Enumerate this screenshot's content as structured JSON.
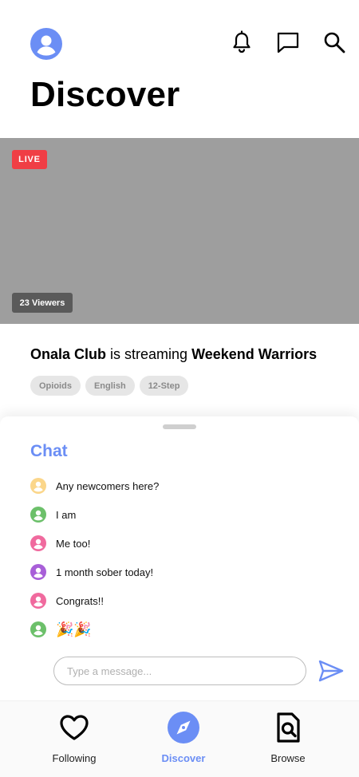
{
  "header": {
    "title": "Discover",
    "icons": [
      "profile-icon",
      "bell-icon",
      "chat-bubble-icon",
      "search-icon"
    ]
  },
  "stream": {
    "live_label": "LIVE",
    "viewers_label": "23 Viewers",
    "host": "Onala Club",
    "connector": " is streaming ",
    "show": "Weekend Warriors",
    "tags": [
      "Opioids",
      "English",
      "12-Step"
    ]
  },
  "chat": {
    "title": "Chat",
    "messages": [
      {
        "text": "Any newcomers here?",
        "avatar_color": "#fbd68a"
      },
      {
        "text": "I am",
        "avatar_color": "#6cc06a"
      },
      {
        "text": "Me too!",
        "avatar_color": "#f06a9e"
      },
      {
        "text": "1 month sober today!",
        "avatar_color": "#a85fd8"
      },
      {
        "text": "Congrats!!",
        "avatar_color": "#f06a9e"
      },
      {
        "text": "🎉🎉",
        "avatar_color": "#6cc06a"
      }
    ],
    "input_placeholder": "Type a message..."
  },
  "nav": {
    "items": [
      {
        "label": "Following",
        "icon": "heart-icon",
        "active": false
      },
      {
        "label": "Discover",
        "icon": "compass-icon",
        "active": true
      },
      {
        "label": "Browse",
        "icon": "document-search-icon",
        "active": false
      }
    ]
  },
  "colors": {
    "accent": "#6b8ef5",
    "live": "#f03e45",
    "stream_placeholder": "#9e9e9e"
  }
}
